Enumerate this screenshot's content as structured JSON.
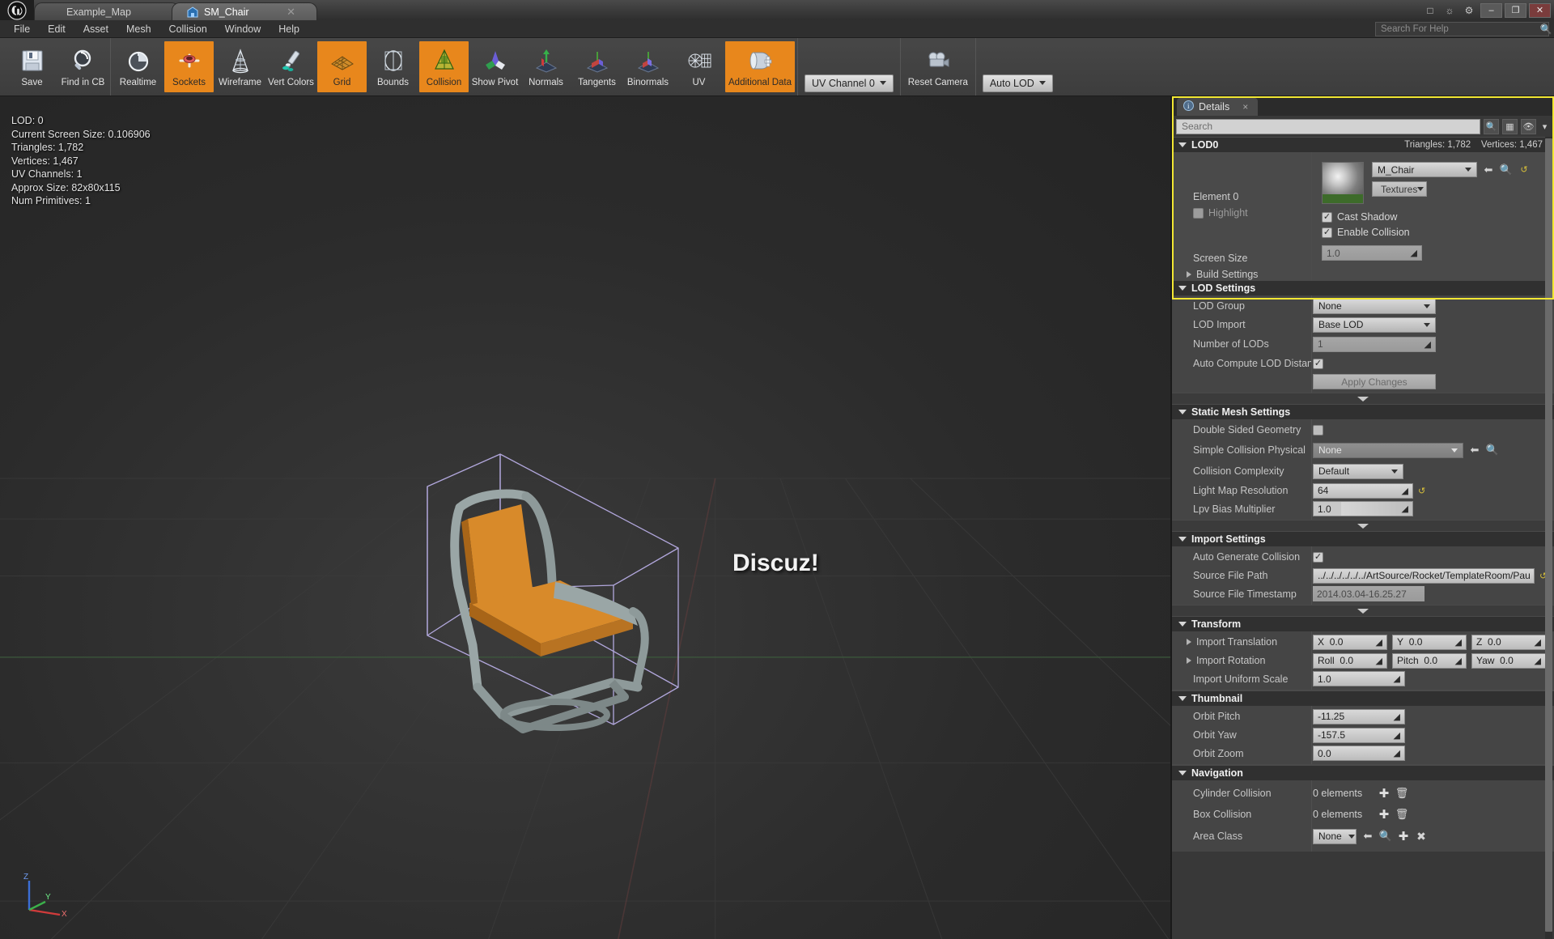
{
  "window": {
    "logo": "unreal-engine-logo",
    "tabs": [
      {
        "label": "Example_Map",
        "icon": "map-icon",
        "active": false,
        "closable": false
      },
      {
        "label": "SM_Chair",
        "icon": "static-mesh-icon",
        "active": true,
        "closable": true
      }
    ],
    "title_icons": [
      "console-icon",
      "feedback-icon",
      "settings-icon"
    ],
    "controls": {
      "minimize": "–",
      "maximize": "❐",
      "close": "✕"
    }
  },
  "menubar": {
    "items": [
      "File",
      "Edit",
      "Asset",
      "Mesh",
      "Collision",
      "Window",
      "Help"
    ],
    "search_placeholder": "Search For Help",
    "search_icon": "search-icon"
  },
  "toolbar": {
    "groups": [
      {
        "tools": [
          {
            "label": "Save",
            "icon": "floppy-disk-icon",
            "active": false
          },
          {
            "label": "Find in CB",
            "icon": "magnifier-icon",
            "active": false
          }
        ]
      },
      {
        "tools": [
          {
            "label": "Realtime",
            "icon": "stopwatch-icon",
            "active": false
          },
          {
            "label": "Sockets",
            "icon": "socket-icon",
            "active": true
          },
          {
            "label": "Wireframe",
            "icon": "wireframe-cone-icon",
            "active": false
          },
          {
            "label": "Vert Colors",
            "icon": "vertex-color-brush-icon",
            "active": false
          },
          {
            "label": "Grid",
            "icon": "grid-icon",
            "active": true
          },
          {
            "label": "Bounds",
            "icon": "bounds-icon",
            "active": false
          },
          {
            "label": "Collision",
            "icon": "collision-icon",
            "active": true
          },
          {
            "label": "Show Pivot",
            "icon": "pivot-icon",
            "active": false
          },
          {
            "label": "Normals",
            "icon": "normals-icon",
            "active": false
          },
          {
            "label": "Tangents",
            "icon": "tangents-icon",
            "active": false
          },
          {
            "label": "Binormals",
            "icon": "binormals-icon",
            "active": false
          },
          {
            "label": "UV",
            "icon": "uv-icon",
            "active": false
          },
          {
            "label": "Additional Data",
            "icon": "additional-data-icon",
            "active": true
          }
        ]
      },
      {
        "combo": {
          "label": "UV Channel 0",
          "icon": "chevron-down-icon"
        }
      },
      {
        "tools": [
          {
            "label": "Reset Camera",
            "icon": "camera-icon",
            "active": false
          }
        ]
      },
      {
        "combo": {
          "label": "Auto LOD",
          "icon": "chevron-down-icon"
        }
      }
    ]
  },
  "viewport": {
    "stats": [
      "LOD: 0",
      "Current Screen Size: 0.106906",
      "Triangles: 1,782",
      "Vertices: 1,467",
      "UV Channels: 1",
      "Approx Size: 82x80x115",
      "Num Primitives: 1"
    ],
    "watermark": "Discuz!",
    "axis_labels": {
      "x": "X",
      "y": "Y",
      "z": "Z"
    },
    "mesh_name": "SM_Chair"
  },
  "details": {
    "tab_label": "Details",
    "tab_icon": "details-info-icon",
    "tab_close": "×",
    "search": {
      "placeholder": "Search",
      "value": "",
      "icon": "search-icon"
    },
    "buttons": [
      {
        "name": "display-options-button",
        "icon": "grid-view-icon"
      },
      {
        "name": "visibility-button",
        "icon": "eye-icon"
      },
      {
        "name": "options-dropdown-button",
        "icon": "chevron-down-icon"
      }
    ],
    "sections": {
      "lod0": {
        "title": "LOD0",
        "triangles": "Triangles: 1,782",
        "vertices": "Vertices: 1,467",
        "element_label": "Element 0",
        "highlight_label": "Highlight",
        "highlight_checked": false,
        "material": "M_Chair",
        "textures_button": "Textures",
        "cast_shadow_label": "Cast Shadow",
        "cast_shadow_checked": true,
        "enable_collision_label": "Enable Collision",
        "enable_collision_checked": true,
        "screen_size_label": "Screen Size",
        "screen_size_value": "1.0",
        "build_settings_label": "Build Settings"
      },
      "lod_settings": {
        "title": "LOD Settings",
        "rows": [
          {
            "label": "LOD Group",
            "type": "combo",
            "value": "None"
          },
          {
            "label": "LOD Import",
            "type": "combo",
            "value": "Base LOD"
          },
          {
            "label": "Number of LODs",
            "type": "spin-dim",
            "value": "1"
          },
          {
            "label": "Auto Compute LOD Distan",
            "type": "check",
            "checked": true
          },
          {
            "label": "",
            "type": "button",
            "value": "Apply Changes"
          }
        ]
      },
      "static_mesh_settings": {
        "title": "Static Mesh Settings",
        "rows": [
          {
            "label": "Double Sided Geometry",
            "type": "check",
            "checked": false
          },
          {
            "label": "Simple Collision Physical",
            "type": "combo-asset",
            "value": "None"
          },
          {
            "label": "Collision Complexity",
            "type": "combo",
            "value": "Default"
          },
          {
            "label": "Light Map Resolution",
            "type": "spin-reset",
            "value": "64"
          },
          {
            "label": "Lpv Bias Multiplier",
            "type": "spin-slider",
            "value": "1.0"
          }
        ]
      },
      "import_settings": {
        "title": "Import Settings",
        "rows": [
          {
            "label": "Auto Generate Collision",
            "type": "check",
            "checked": true
          },
          {
            "label": "Source File Path",
            "type": "text-reset",
            "value": "../../../../../../ArtSource/Rocket/TemplateRoom/Paul"
          },
          {
            "label": "Source File Timestamp",
            "type": "text-dim",
            "value": "2014.03.04-16.25.27"
          }
        ]
      },
      "transform": {
        "title": "Transform",
        "rows": [
          {
            "label": "Import Translation",
            "type": "vector",
            "expandable": true,
            "fields": [
              {
                "axis": "X",
                "value": "0.0"
              },
              {
                "axis": "Y",
                "value": "0.0"
              },
              {
                "axis": "Z",
                "value": "0.0"
              }
            ]
          },
          {
            "label": "Import Rotation",
            "type": "vector",
            "expandable": true,
            "fields": [
              {
                "axis": "Roll",
                "value": "0.0"
              },
              {
                "axis": "Pitch",
                "value": "0.0"
              },
              {
                "axis": "Yaw",
                "value": "0.0"
              }
            ]
          },
          {
            "label": "Import Uniform Scale",
            "type": "spin",
            "value": "1.0"
          }
        ]
      },
      "thumbnail": {
        "title": "Thumbnail",
        "rows": [
          {
            "label": "Orbit Pitch",
            "type": "spin",
            "value": "-11.25"
          },
          {
            "label": "Orbit Yaw",
            "type": "spin",
            "value": "-157.5"
          },
          {
            "label": "Orbit Zoom",
            "type": "spin",
            "value": "0.0"
          }
        ]
      },
      "navigation": {
        "title": "Navigation",
        "rows": [
          {
            "label": "Cylinder Collision",
            "type": "array",
            "value": "0 elements",
            "icons": [
              "plus-icon",
              "trash-icon"
            ]
          },
          {
            "label": "Box Collision",
            "type": "array",
            "value": "0 elements",
            "icons": [
              "plus-icon",
              "trash-icon"
            ]
          },
          {
            "label": "Area Class",
            "type": "asset-pick",
            "value": "None",
            "icons": [
              "back-arrow-icon",
              "browse-icon",
              "plus-icon",
              "clear-x-icon"
            ]
          }
        ]
      }
    }
  },
  "colors": {
    "accent_orange": "#e8871c",
    "highlight_yellow": "#f2e733",
    "panel_bg": "#383838",
    "section_bg": "#303030",
    "toolbar_bg": "#434343"
  }
}
